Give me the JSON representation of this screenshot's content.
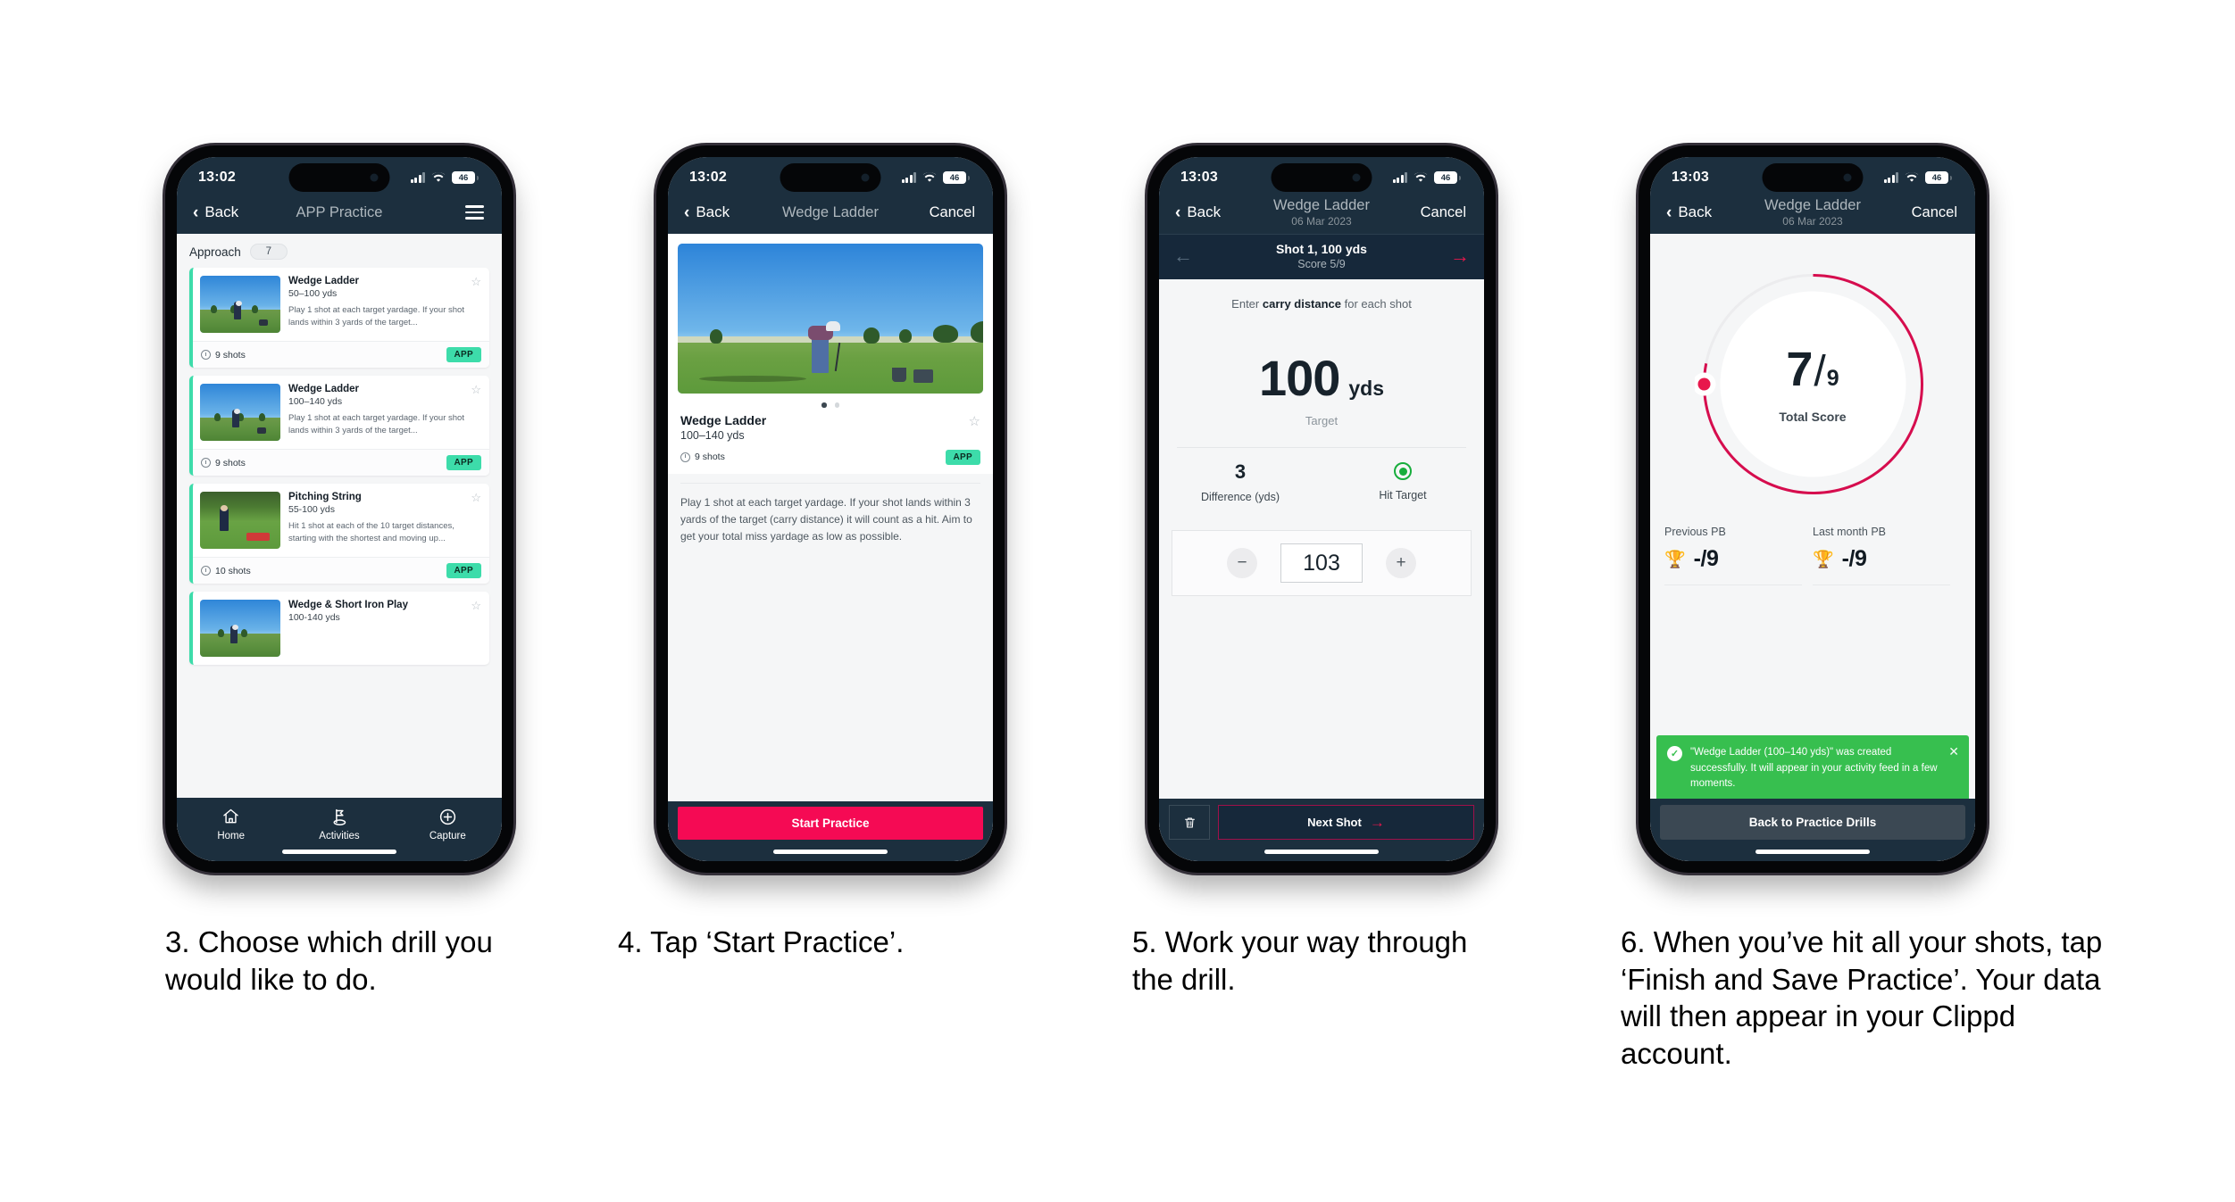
{
  "phones": [
    {
      "id": "phone-drill-list",
      "status": {
        "time": "13:02",
        "battery": "46"
      },
      "nav": {
        "back": "Back",
        "title": "APP Practice",
        "menu_icon": "hamburger-icon"
      },
      "category": {
        "name": "Approach",
        "count": "7"
      },
      "drills": [
        {
          "title": "Wedge Ladder",
          "range": "50–100 yds",
          "desc": "Play 1 shot at each target yardage. If your shot lands within 3 yards of the target...",
          "shots": "9 shots",
          "tag": "APP"
        },
        {
          "title": "Wedge Ladder",
          "range": "100–140 yds",
          "desc": "Play 1 shot at each target yardage. If your shot lands within 3 yards of the target...",
          "shots": "9 shots",
          "tag": "APP"
        },
        {
          "title": "Pitching String",
          "range": "55-100 yds",
          "desc": "Hit 1 shot at each of the 10 target distances, starting with the shortest and moving up...",
          "shots": "10 shots",
          "tag": "APP"
        },
        {
          "title": "Wedge & Short Iron Play",
          "range": "100-140 yds",
          "desc": "",
          "shots": "",
          "tag": ""
        }
      ],
      "tabs": [
        {
          "label": "Home",
          "icon": "home-icon"
        },
        {
          "label": "Activities",
          "icon": "golf-flag-icon"
        },
        {
          "label": "Capture",
          "icon": "plus-circle-icon"
        }
      ]
    },
    {
      "id": "phone-drill-detail",
      "status": {
        "time": "13:02",
        "battery": "46"
      },
      "nav": {
        "back": "Back",
        "title": "Wedge Ladder",
        "right": "Cancel"
      },
      "detail": {
        "title": "Wedge Ladder",
        "range": "100–140 yds",
        "shots": "9 shots",
        "tag": "APP",
        "description": "Play 1 shot at each target yardage. If your shot lands within 3 yards of the target (carry distance) it will count as a hit. Aim to get your total miss yardage as low as possible."
      },
      "cta": "Start Practice"
    },
    {
      "id": "phone-shot-entry",
      "status": {
        "time": "13:03",
        "battery": "46"
      },
      "nav": {
        "back": "Back",
        "title": "Wedge Ladder",
        "subtitle": "06 Mar 2023",
        "right": "Cancel"
      },
      "shotbar": {
        "title": "Shot 1, 100 yds",
        "score": "Score 5/9",
        "prev_icon": "arrow-left-icon",
        "next_icon": "arrow-right-icon"
      },
      "prompt_pre": "Enter ",
      "prompt_bold": "carry distance",
      "prompt_post": " for each shot",
      "target": {
        "value": "100",
        "unit": "yds",
        "label": "Target"
      },
      "stats": [
        {
          "value": "3",
          "label": "Difference (yds)"
        },
        {
          "value": "",
          "label": "Hit Target",
          "icon": "target-hit-icon"
        }
      ],
      "stepper": {
        "minus": "−",
        "value": "103",
        "plus": "+"
      },
      "footer": {
        "delete_icon": "trash-icon",
        "next": "Next Shot",
        "next_icon": "arrow-right-icon"
      }
    },
    {
      "id": "phone-summary",
      "status": {
        "time": "13:03",
        "battery": "46"
      },
      "nav": {
        "back": "Back",
        "title": "Wedge Ladder",
        "subtitle": "06 Mar 2023",
        "right": "Cancel"
      },
      "ring": {
        "score": "7",
        "separator": "/",
        "total": "9",
        "label": "Total Score",
        "percent": 78,
        "color": "#d60d4e"
      },
      "pbs": [
        {
          "label": "Previous PB",
          "value": "-/9",
          "icon": "trophy-icon"
        },
        {
          "label": "Last month PB",
          "value": "-/9",
          "icon": "trophy-icon"
        }
      ],
      "toast": {
        "icon": "check-circle-icon",
        "message": "\"Wedge Ladder (100–140 yds)\" was created successfully. It will appear in your activity feed in a few moments.",
        "close_icon": "close-icon"
      },
      "cta": "Back to Practice Drills"
    }
  ],
  "captions": [
    "3. Choose which drill you would like to do.",
    "4. Tap ‘Start Practice’.",
    "5. Work your way through the drill.",
    "6. When you’ve hit all your shots, tap ‘Finish and Save Practice’. Your data will then appear in your Clippd account."
  ],
  "colors": {
    "navbar": "#1c2f3e",
    "accent_pink": "#f50a54",
    "accent_teal": "#3ddcaa",
    "toast_green": "#37bf4f",
    "ring_pink": "#d60d4e"
  }
}
